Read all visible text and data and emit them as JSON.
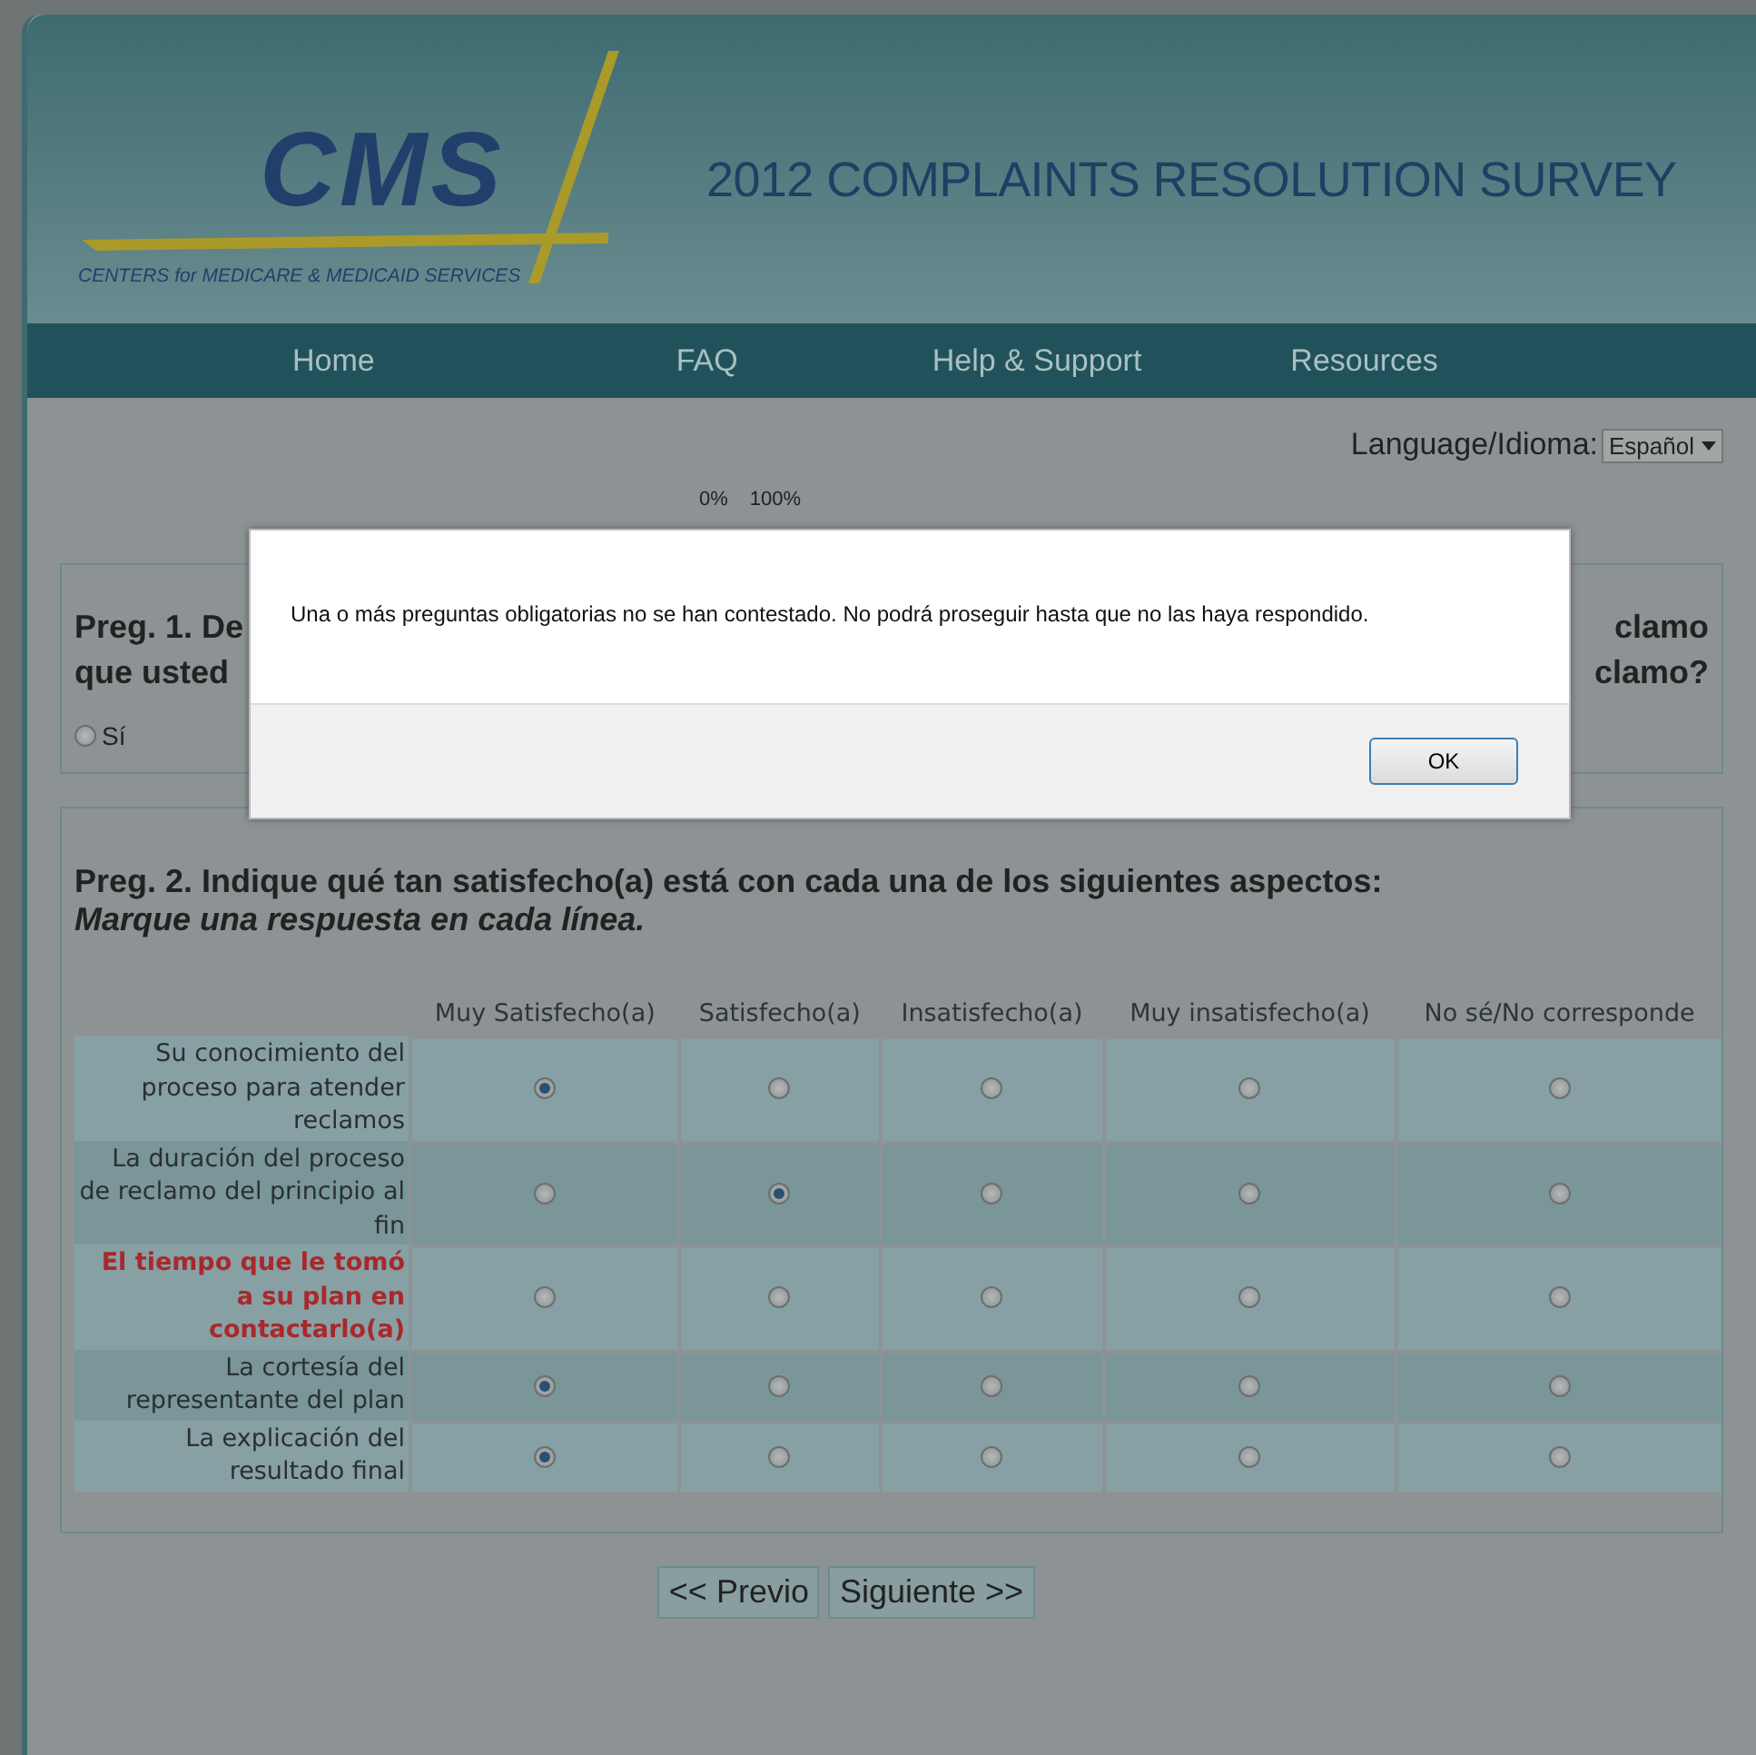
{
  "header": {
    "logo_text": "CMS",
    "logo_subtitle": "CENTERS for MEDICARE & MEDICAID SERVICES",
    "title": "2012 COMPLAINTS RESOLUTION SURVEY"
  },
  "nav": [
    {
      "label": "Home"
    },
    {
      "label": "FAQ"
    },
    {
      "label": "Help & Support"
    },
    {
      "label": "Resources"
    }
  ],
  "language": {
    "label": "Language/Idioma:",
    "value": "Español"
  },
  "progress": {
    "start": "0%",
    "end": "100%"
  },
  "question_1": {
    "lines": [
      {
        "left": "Preg. 1. De",
        "right": "clamo"
      },
      {
        "left": "que usted",
        "right": "clamo?"
      }
    ],
    "options": [
      {
        "label": "Sí",
        "selected": false
      }
    ]
  },
  "question_2": {
    "title": "Preg. 2. Indique qué tan satisfecho(a) está con cada una de los siguientes aspectos:",
    "instruction": "Marque una respuesta en cada línea.",
    "columns": [
      "Muy Satisfecho(a)",
      "Satisfecho(a)",
      "Insatisfecho(a)",
      "Muy insatisfecho(a)",
      "No sé/No corresponde"
    ],
    "rows": [
      {
        "label": "Su conocimiento del proceso para atender reclamos",
        "error": false,
        "options": [
          {
            "selected": true
          },
          {
            "selected": false
          },
          {
            "selected": false
          },
          {
            "selected": false
          },
          {
            "selected": false
          }
        ]
      },
      {
        "label": "La duración del proceso de reclamo del principio al fin",
        "error": false,
        "options": [
          {
            "selected": false
          },
          {
            "selected": true
          },
          {
            "selected": false
          },
          {
            "selected": false
          },
          {
            "selected": false
          }
        ]
      },
      {
        "label": "El tiempo que le tomó a su plan en contactarlo(a)",
        "error": true,
        "options": [
          {
            "selected": false
          },
          {
            "selected": false
          },
          {
            "selected": false
          },
          {
            "selected": false
          },
          {
            "selected": false
          }
        ]
      },
      {
        "label": "La cortesía del representante del plan",
        "error": false,
        "options": [
          {
            "selected": true
          },
          {
            "selected": false
          },
          {
            "selected": false
          },
          {
            "selected": false
          },
          {
            "selected": false
          }
        ]
      },
      {
        "label": "La explicación del resultado final",
        "error": false,
        "options": [
          {
            "selected": true
          },
          {
            "selected": false
          },
          {
            "selected": false
          },
          {
            "selected": false
          },
          {
            "selected": false
          }
        ]
      }
    ]
  },
  "buttons": [
    {
      "label": "<< Previo"
    },
    {
      "label": "Siguiente >>"
    }
  ],
  "dialog": {
    "message": "Una o más preguntas obligatorias no se han contestado. No podrá proseguir hasta que no las haya respondido.",
    "button": "OK"
  }
}
